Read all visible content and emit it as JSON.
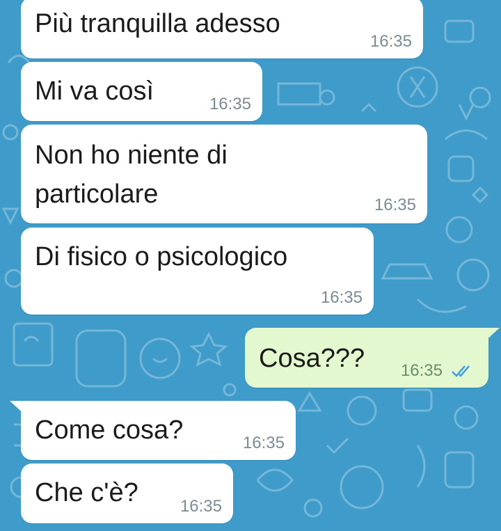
{
  "chat": {
    "background_color": "#3f9bc9",
    "incoming_bubble_color": "#ffffff",
    "outgoing_bubble_color": "#e3f8cf",
    "read_tick_color": "#3ca0e8",
    "messages": [
      {
        "direction": "in",
        "text": "Più tranquilla adesso",
        "time": "16:35"
      },
      {
        "direction": "in",
        "text": "Mi va così",
        "time": "16:35"
      },
      {
        "direction": "in",
        "text_line1": "Non ho niente di",
        "text_line2": "particolare",
        "time": "16:35"
      },
      {
        "direction": "in",
        "text": "Di fisico o psicologico",
        "time": "16:35"
      },
      {
        "direction": "out",
        "text": "Cosa???",
        "time": "16:35",
        "status": "read",
        "status_icon": "double-check-icon"
      },
      {
        "direction": "in",
        "text": "Come cosa?",
        "time": "16:35"
      },
      {
        "direction": "in",
        "text": "Che c'è?",
        "time": "16:35"
      }
    ]
  }
}
